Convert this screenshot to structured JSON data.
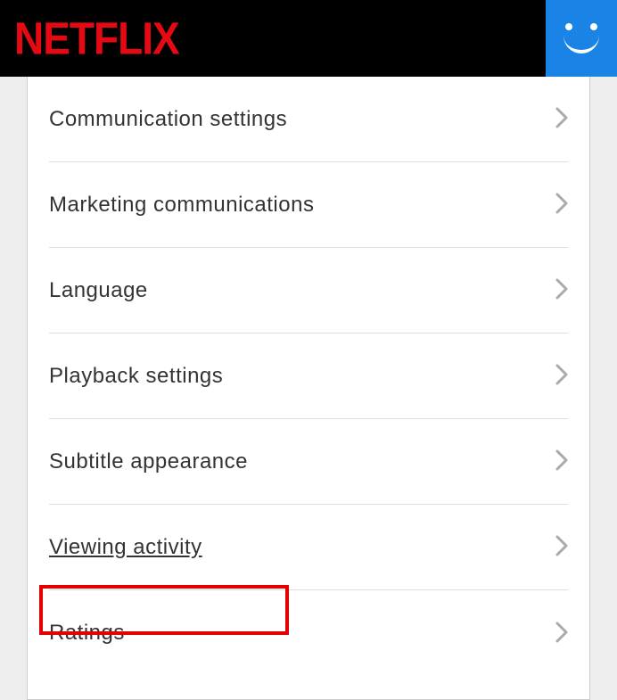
{
  "header": {
    "logo": "NETFLIX"
  },
  "settings": {
    "items": [
      {
        "label": "Communication settings"
      },
      {
        "label": "Marketing communications"
      },
      {
        "label": "Language"
      },
      {
        "label": "Playback settings"
      },
      {
        "label": "Subtitle appearance"
      },
      {
        "label": "Viewing activity"
      },
      {
        "label": "Ratings"
      }
    ]
  }
}
